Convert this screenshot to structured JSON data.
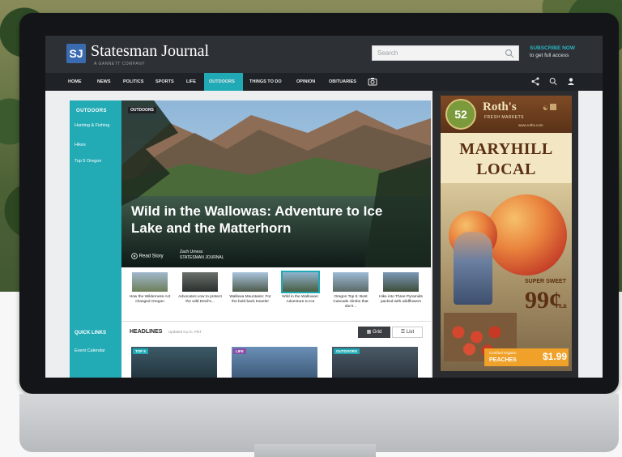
{
  "brand": {
    "initials": "SJ",
    "name": "Statesman Journal",
    "tagline": "A GANNETT COMPANY"
  },
  "search": {
    "placeholder": "Search"
  },
  "subscribe": {
    "title": "SUBSCRIBE NOW",
    "text": "to get full access"
  },
  "nav": {
    "items": [
      "HOME",
      "NEWS",
      "POLITICS",
      "SPORTS",
      "LIFE",
      "OUTDOORS",
      "THINGS TO DO",
      "OPINION",
      "OBITUARIES"
    ],
    "active": "OUTDOORS"
  },
  "nav_icons": [
    "camera-icon",
    "share-icon",
    "search-icon",
    "user-icon"
  ],
  "sidebar": {
    "title": "OUTDOORS",
    "items": [
      "Hunting & Fishing",
      "Hikes",
      "Top 5 Oregon"
    ],
    "quick_links_title": "QUICK LINKS",
    "quick_links": [
      "Event Calendar"
    ]
  },
  "hero": {
    "tag": "OUTDOORS",
    "title": "Wild in the Wallowas: Adventure to Ice Lake and the Matterhorn",
    "read_story": "Read Story",
    "author": "Zach Urness",
    "source": "STATESMAN JOURNAL"
  },
  "thumbs": [
    {
      "caption": "How the Wilderness Act changed Oregon"
    },
    {
      "caption": "Advocates vow to protect the wild Devil's..."
    },
    {
      "caption": "Wallowa Mountains: For the bold back traveler"
    },
    {
      "caption": "Wild in the Wallowas: Adventure to Ice"
    },
    {
      "caption": "Oregon Top 5: Best Cascade climbs that don't..."
    },
    {
      "caption": "Hike into Three Pyramids packed with wildflowers"
    }
  ],
  "headlines": {
    "title": "HEADLINES",
    "updated": "Updated 9 p.m. PDT",
    "grid_label": "Grid",
    "list_label": "List"
  },
  "cards": [
    {
      "tag": "TOP 5"
    },
    {
      "tag": "LIFE"
    },
    {
      "tag": "OUTDOORS"
    }
  ],
  "ad": {
    "badge": "52",
    "brand": "Roth's",
    "brand_sub": "FRESH MARKETS",
    "url": "www.roths.com",
    "headline_line1": "MARYHILL",
    "headline_line2": "LOCAL PEACHES",
    "sweet_line1": "SUPER",
    "sweet_line2": "SWEET",
    "price": "99¢",
    "unit": "/LB",
    "cert_small": "Certified Organic",
    "cert_large": "PEACHES",
    "cert_price": "$1.99"
  },
  "colors": {
    "accent": "#20aab5",
    "header": "#2d3035",
    "nav": "#1f2226",
    "brand_box": "#3a6bb1"
  }
}
